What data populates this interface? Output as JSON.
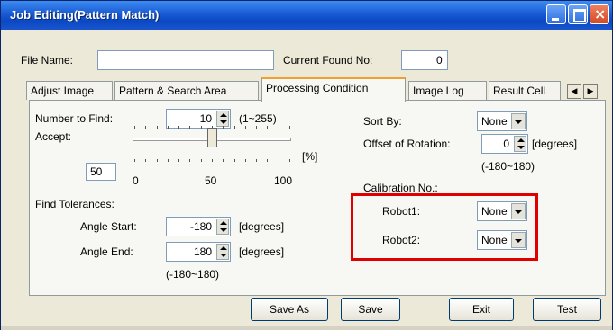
{
  "window": {
    "title": "Job Editing(Pattern Match)",
    "close_symbol": "×"
  },
  "header": {
    "file_name_label": "File Name:",
    "file_name_value": "",
    "current_found_label": "Current Found No:",
    "current_found_value": "0"
  },
  "tabs": [
    {
      "label": "Adjust Image"
    },
    {
      "label": "Pattern & Search Area"
    },
    {
      "label": "Processing Condition",
      "active": true
    },
    {
      "label": "Image Log"
    },
    {
      "label": "Result Cell"
    }
  ],
  "tab_scroll": {
    "left": "◀",
    "right": "▶"
  },
  "condition": {
    "number_to_find_label": "Number to Find:",
    "number_to_find_value": "10",
    "number_to_find_range": "(1~255)",
    "accept_label": "Accept:",
    "accept_value": "50",
    "accept_unit": "[%]",
    "accept_min": "0",
    "accept_mid": "50",
    "accept_max": "100",
    "accept_slider_fraction": 0.5,
    "find_tolerances_label": "Find Tolerances:",
    "angle_start_label": "Angle Start:",
    "angle_start_value": "-180",
    "angle_start_unit": "[degrees]",
    "angle_end_label": "Angle End:",
    "angle_end_value": "180",
    "angle_end_unit": "[degrees]",
    "angle_range": "(-180~180)",
    "sort_by_label": "Sort By:",
    "sort_by_value": "None",
    "offset_rotation_label": "Offset of Rotation:",
    "offset_rotation_value": "0",
    "offset_rotation_unit": "[degrees]",
    "offset_rotation_range": "(-180~180)",
    "calibration_label": "Calibration No.:",
    "robot1_label": "Robot1:",
    "robot1_value": "None",
    "robot2_label": "Robot2:",
    "robot2_value": "None"
  },
  "buttons": {
    "save_as": "Save As",
    "save": "Save",
    "exit": "Exit",
    "test": "Test"
  },
  "colors": {
    "title_blue": "#1c5fd8",
    "highlight_red": "#e00000",
    "window_bg": "#ece9d8"
  }
}
